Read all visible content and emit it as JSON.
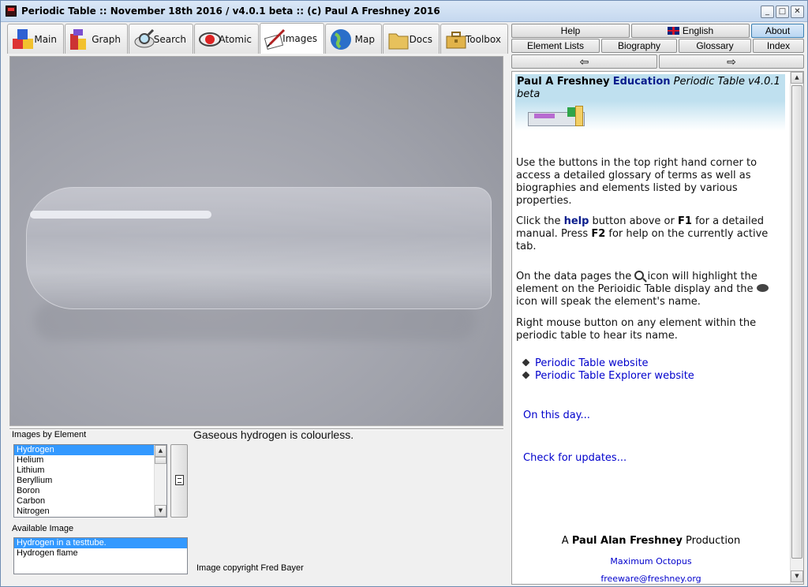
{
  "window": {
    "title": "Periodic Table :: November 18th 2016 / v4.0.1 beta :: (c) Paul A Freshney 2016",
    "controls": {
      "minimize": "_",
      "maximize": "□",
      "close": "✕"
    }
  },
  "tabs": [
    {
      "label": "Main",
      "icon": "cubes-icon",
      "active": false
    },
    {
      "label": "Graph",
      "icon": "graph-cubes-icon",
      "active": false
    },
    {
      "label": "Search",
      "icon": "magnifier-icon",
      "active": false
    },
    {
      "label": "Atomic",
      "icon": "atom-icon",
      "active": false
    },
    {
      "label": "Images",
      "icon": "image-pen-icon",
      "active": true
    },
    {
      "label": "Map",
      "icon": "globe-icon",
      "active": false
    },
    {
      "label": "Docs",
      "icon": "folder-icon",
      "active": false
    },
    {
      "label": "Toolbox",
      "icon": "toolbox-icon",
      "active": false
    }
  ],
  "left": {
    "images_by_element_label": "Images by Element",
    "elements": [
      "Hydrogen",
      "Helium",
      "Lithium",
      "Beryllium",
      "Boron",
      "Carbon",
      "Nitrogen"
    ],
    "selected_element": "Hydrogen",
    "available_image_label": "Available Image",
    "images": [
      "Hydrogen in a testtube.",
      "Hydrogen flame"
    ],
    "selected_image": "Hydrogen in a testtube.",
    "caption": "Gaseous hydrogen is colourless.",
    "copyright": "Image copyright Fred Bayer"
  },
  "nav": {
    "help": "Help",
    "english": "English",
    "about": "About",
    "element_lists": "Element Lists",
    "biography": "Biography",
    "glossary": "Glossary",
    "index": "Index",
    "back": "⇦",
    "forward": "⇨"
  },
  "info": {
    "header_name": "Paul A Freshney",
    "header_edu": "Education",
    "header_product": "Periodic Table v4.0.1 beta",
    "p1": "Use the buttons in the top right hand corner to access a detailed glossary of terms as well as biographies and elements listed by various properties.",
    "p2_a": "Click the ",
    "p2_help": "help",
    "p2_b": " button above or ",
    "p2_f1": "F1",
    "p2_c": " for a detailed manual. Press ",
    "p2_f2": "F2",
    "p2_d": " for help on the currently active tab.",
    "p3_a": "On the data pages the ",
    "p3_b": " icon will highlight the element on the Perioidic Table display and the ",
    "p3_c": " icon will speak the element's name.",
    "p4": "Right mouse button on any element within the periodic table to hear its name.",
    "link1": "Periodic Table website",
    "link2": "Periodic Table Explorer website",
    "link3": "On this day...",
    "link4": "Check for updates...",
    "footer_a": "A ",
    "footer_name": "Paul Alan Freshney",
    "footer_b": " Production",
    "footer_octopus": "Maximum Octopus",
    "footer_email": "freeware@freshney.org"
  }
}
